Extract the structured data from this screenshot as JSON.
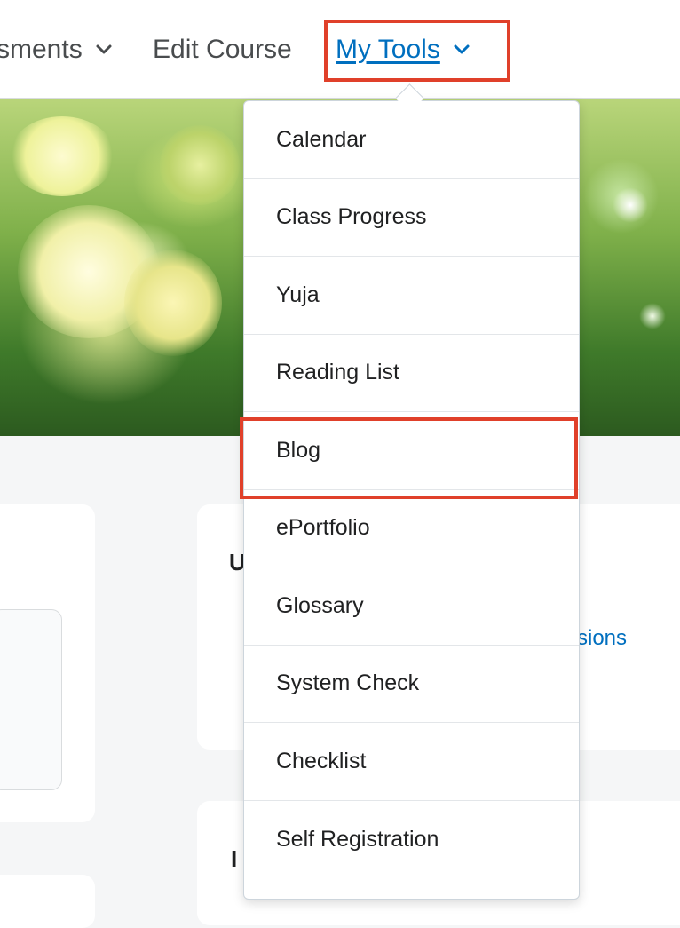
{
  "nav": {
    "assessments_label": "sments",
    "edit_course_label": "Edit Course",
    "my_tools_label": "My Tools"
  },
  "dropdown": {
    "items": [
      {
        "label": "Calendar"
      },
      {
        "label": "Class Progress"
      },
      {
        "label": "Yuja"
      },
      {
        "label": "Reading List"
      },
      {
        "label": "Blog"
      },
      {
        "label": "ePortfolio"
      },
      {
        "label": "Glossary"
      },
      {
        "label": "System Check"
      },
      {
        "label": "Checklist"
      },
      {
        "label": "Self Registration"
      }
    ]
  },
  "cards": {
    "partial_heading_1": "U",
    "partial_link": "sions",
    "partial_heading_2": "I"
  },
  "colors": {
    "accent_link": "#006fbf",
    "highlight": "#e0402a",
    "text": "#202122"
  },
  "icons": {
    "nav_chevron": "chevron-down-icon",
    "banner": "flower-banner-image"
  }
}
